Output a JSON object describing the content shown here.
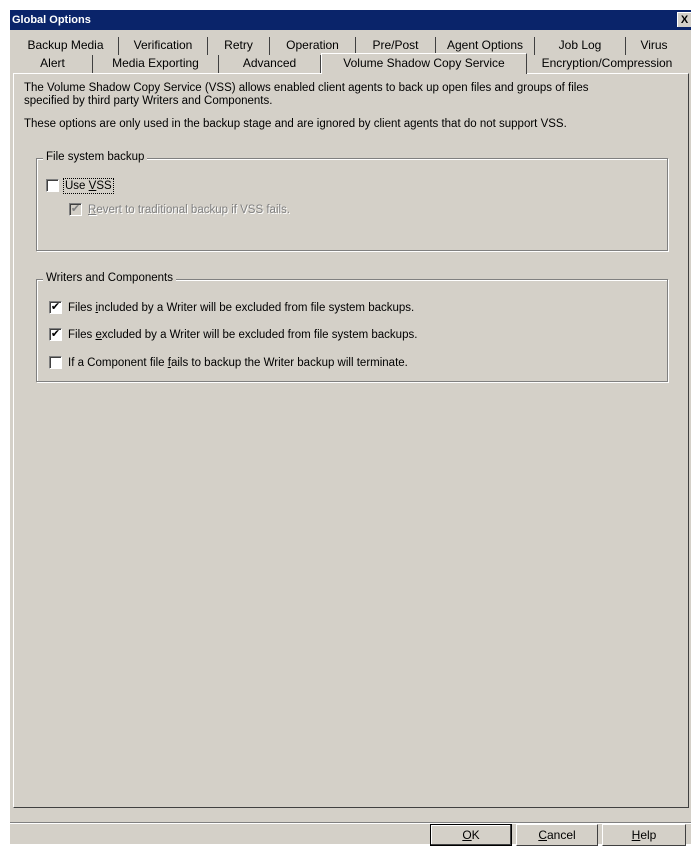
{
  "window": {
    "title": "Global Options",
    "close_label": "X"
  },
  "tabs": {
    "row1": [
      {
        "label": "Backup Media"
      },
      {
        "label": "Verification"
      },
      {
        "label": "Retry"
      },
      {
        "label": "Operation"
      },
      {
        "label": "Pre/Post"
      },
      {
        "label": "Agent Options"
      },
      {
        "label": "Job Log"
      },
      {
        "label": "Virus"
      }
    ],
    "row2": [
      {
        "label": "Alert"
      },
      {
        "label": "Media Exporting"
      },
      {
        "label": "Advanced"
      },
      {
        "label": "Volume Shadow Copy Service",
        "active": true
      },
      {
        "label": "Encryption/Compression"
      }
    ]
  },
  "panel": {
    "description_line1": "The Volume Shadow Copy Service (VSS) allows enabled client agents to back up open files and groups of files",
    "description_line2": "specified by third party Writers and Components.",
    "description_line3": "These options are only used in the backup stage and are ignored by client agents that do not support VSS.",
    "file_system_backup": {
      "title": "File system backup",
      "use_vss": {
        "pre": "Use ",
        "accel": "V",
        "post": "SS",
        "checked": false
      },
      "revert": {
        "accel": "R",
        "post": "evert to traditional backup if VSS fails.",
        "checked": true,
        "disabled": true
      }
    },
    "writers": {
      "title": "Writers and Components",
      "opt1": {
        "pre": "Files ",
        "accel": "i",
        "post": "ncluded by a Writer will be excluded from file system backups.",
        "checked": true
      },
      "opt2": {
        "pre": "Files ",
        "accel": "e",
        "post": "xcluded by a Writer will be excluded from file system backups.",
        "checked": true
      },
      "opt3": {
        "pre": "If a Component file ",
        "accel": "f",
        "post": "ails to backup the Writer backup will terminate.",
        "checked": false
      }
    }
  },
  "buttons": {
    "ok": {
      "accel": "O",
      "post": "K"
    },
    "cancel": {
      "accel": "C",
      "post": "ancel"
    },
    "help": {
      "accel": "H",
      "post": "elp"
    }
  },
  "check_mark": "✔"
}
